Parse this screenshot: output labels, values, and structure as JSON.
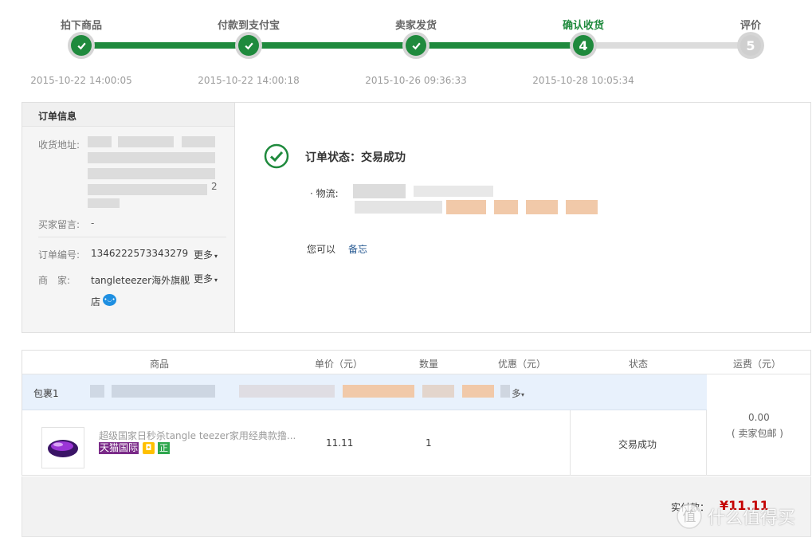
{
  "steps": [
    {
      "label": "拍下商品",
      "time": "2015-10-22 14:00:05",
      "state": "done"
    },
    {
      "label": "付款到支付宝",
      "time": "2015-10-22 14:00:18",
      "state": "done"
    },
    {
      "label": "卖家发货",
      "time": "2015-10-26 09:36:33",
      "state": "done"
    },
    {
      "label": "确认收货",
      "time": "2015-10-28 10:05:34",
      "state": "current",
      "num": "4"
    },
    {
      "label": "评价",
      "time": "",
      "state": "todo",
      "num": "5"
    }
  ],
  "order_info": {
    "title": "订单信息",
    "address_label": "收货地址:",
    "address_tail": "2",
    "message_label": "买家留言:",
    "message_value": "-",
    "order_no_label": "订单编号:",
    "order_no": "1346222573343279",
    "merchant_label": "商　家:",
    "merchant_name": "tangleteezer海外旗舰",
    "merchant_name2": "店",
    "more_label": "更多"
  },
  "status": {
    "title": "订单状态：交易成功",
    "logistics_label": "· 物流:",
    "you_can": "您可以",
    "memo_link": "备忘"
  },
  "table": {
    "headers": [
      "商品",
      "单价（元）",
      "数量",
      "优惠（元）",
      "状态",
      "运费（元）"
    ],
    "package_label": "包裹1",
    "package_more": "多",
    "item": {
      "name": "超级国家日秒杀tangle teezer家用经典款撸...",
      "badge_tmall": "天猫国际",
      "badge_zheng": "正",
      "price": "11.11",
      "qty": "1",
      "status": "交易成功"
    },
    "shipping_value": "0.00",
    "shipping_note": "( 卖家包邮 )"
  },
  "footer": {
    "paid_label": "实付款：",
    "paid_value": "¥11.11"
  },
  "watermark": {
    "text": "什么值得买"
  },
  "colors": {
    "green": "#1f8a3d",
    "price_red": "#c40000",
    "link_blue": "#2b5c94",
    "package_bg": "#e8f1fc"
  }
}
